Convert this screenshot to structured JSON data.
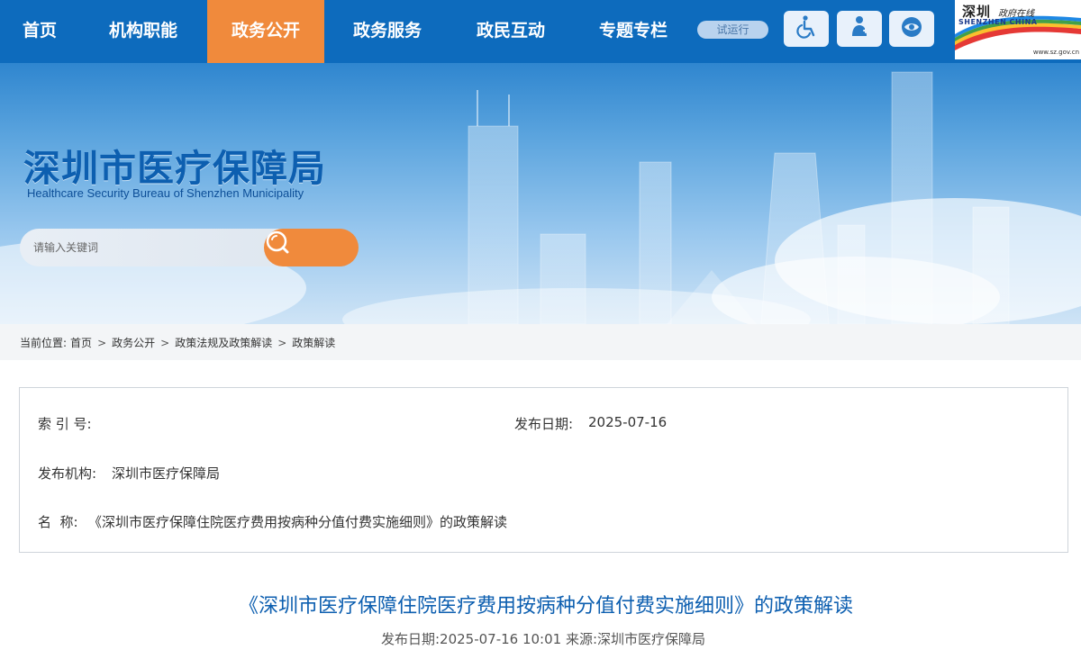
{
  "nav": {
    "items": [
      {
        "label": "首页"
      },
      {
        "label": "机构职能"
      },
      {
        "label": "政务公开"
      },
      {
        "label": "政务服务"
      },
      {
        "label": "政民互动"
      },
      {
        "label": "专题专栏"
      }
    ],
    "active_index": 2,
    "trial_badge": "试运行",
    "accessibility_icons": [
      "wheelchair-icon",
      "elder-care-icon",
      "eye-care-icon"
    ]
  },
  "portal_logo": {
    "seal_text": "深圳",
    "seal_sub": "政府在线",
    "en": "SHENZHEN CHINA",
    "url": "www.sz.gov.cn"
  },
  "header": {
    "title": "深圳市医疗保障局",
    "subtitle": "Healthcare Security Bureau of Shenzhen Municipality"
  },
  "search": {
    "placeholder": "请输入关键词",
    "icon": "search-icon"
  },
  "breadcrumb": {
    "prefix": "当前位置:",
    "items": [
      "首页",
      "政务公开",
      "政策法规及政策解读",
      "政策解读"
    ],
    "separator": ">"
  },
  "info": {
    "index_label": "索 引 号:",
    "index_value": "",
    "date_label": "发布日期:",
    "date_value": "2025-07-16",
    "agency_label": "发布机构:",
    "agency_value": "深圳市医疗保障局",
    "name_label": "名  称:",
    "name_value": "《深圳市医疗保障住院医疗费用按病种分值付费实施细则》的政策解读"
  },
  "article": {
    "title": "《深圳市医疗保障住院医疗费用按病种分值付费实施细则》的政策解读",
    "meta": "发布日期:2025-07-16 10:01  来源:深圳市医疗保障局"
  },
  "colors": {
    "nav_bg": "#0d6bbd",
    "accent_orange": "#f08a3c",
    "title_blue": "#0d5fb0"
  }
}
